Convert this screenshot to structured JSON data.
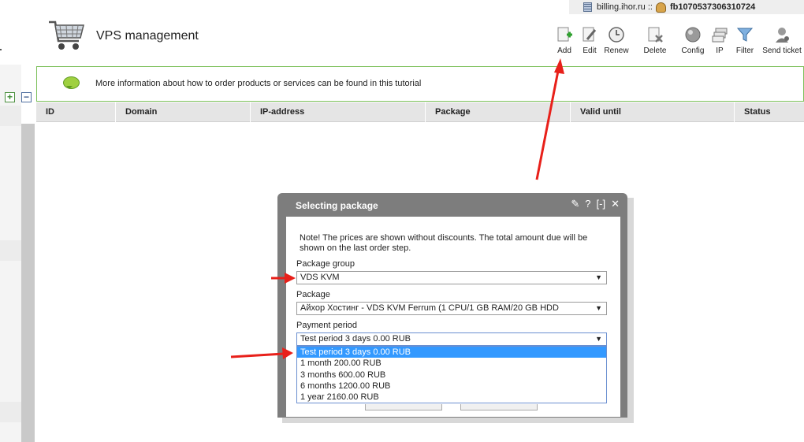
{
  "topbar": {
    "host": "billing.ihor.ru ::",
    "account": "fb1070537306310724"
  },
  "header": {
    "title": "VPS management"
  },
  "toolbar": [
    {
      "label": "Add",
      "icon": "add-document-icon"
    },
    {
      "label": "Edit",
      "icon": "edit-document-icon"
    },
    {
      "label": "Renew",
      "icon": "clock-icon"
    },
    {
      "label": "Delete",
      "icon": "delete-document-icon"
    },
    {
      "label": "Config",
      "icon": "config-ball-icon"
    },
    {
      "label": "IP",
      "icon": "network-cards-icon"
    },
    {
      "label": "Filter",
      "icon": "funnel-icon"
    },
    {
      "label": "Send ticket",
      "icon": "support-agent-icon"
    }
  ],
  "info": {
    "text": "More information about how to order products or services can be found in this tutorial"
  },
  "table": {
    "columns": [
      "ID",
      "Domain",
      "IP-address",
      "Package",
      "Valid until",
      "Status"
    ]
  },
  "dialog": {
    "title": "Selecting package",
    "controls": [
      "✎",
      "?",
      "[-]",
      "✕"
    ],
    "note": "Note! The prices are shown without discounts. The total amount due will be shown on the last order step.",
    "package_group": {
      "label": "Package group",
      "value": "VDS KVM"
    },
    "package": {
      "label": "Package",
      "value": "Айхор Хостинг - VDS KVM Ferrum (1 CPU/1 GB RAM/20 GB HDD"
    },
    "payment_period": {
      "label": "Payment period",
      "value": "Test period 3 days 0.00 RUB",
      "options": [
        "Test period 3 days 0.00 RUB",
        "1 month 200.00 RUB",
        "3 months 600.00 RUB",
        "6 months 1200.00 RUB",
        "1 year 2160.00 RUB"
      ]
    }
  },
  "colors": {
    "annotation_arrow": "#e8201a",
    "dialog_header": "#7d7d7d",
    "selected_option": "#3399ff",
    "info_border": "#7cc05a"
  }
}
